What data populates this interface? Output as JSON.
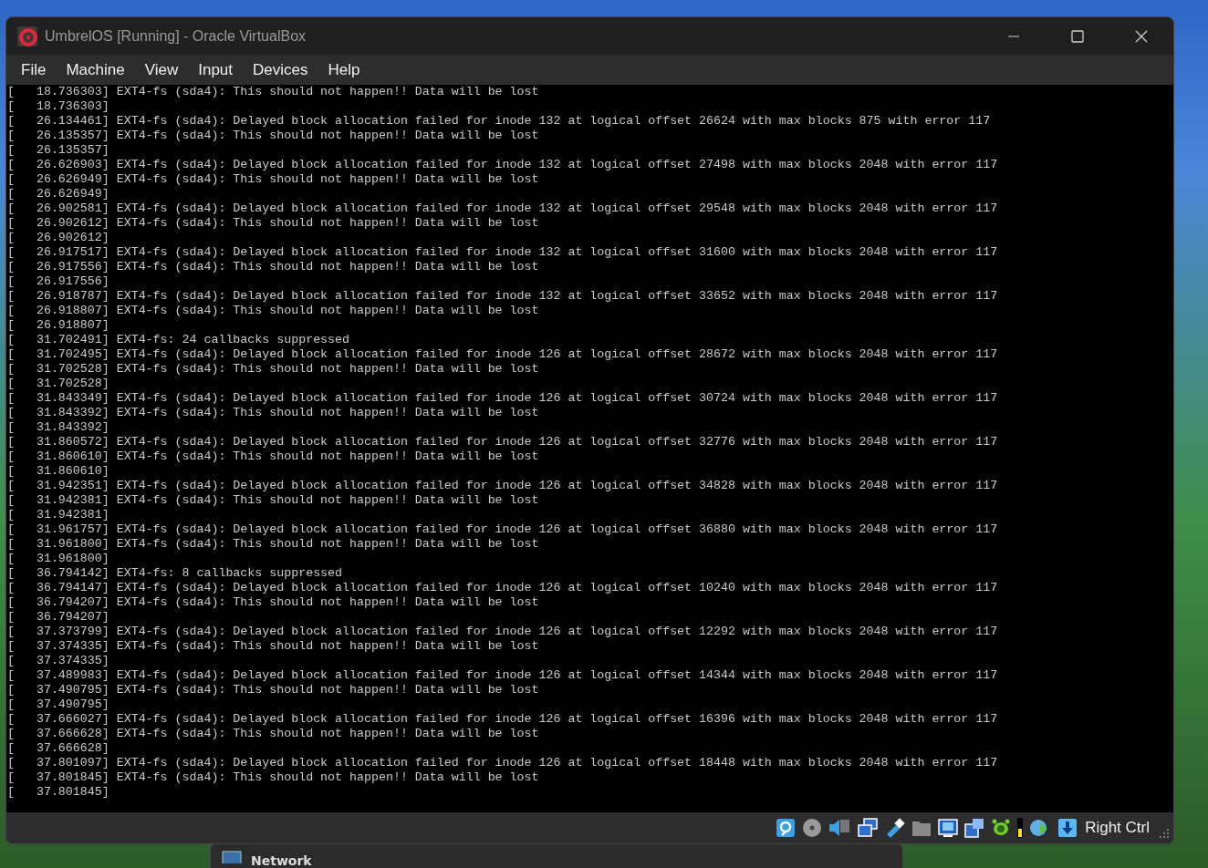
{
  "window": {
    "title": "UmbrelOS [Running] - Oracle VirtualBox"
  },
  "menu": [
    "File",
    "Machine",
    "View",
    "Input",
    "Devices",
    "Help"
  ],
  "console_lines": [
    "[   18.736303] EXT4-fs (sda4): This should not happen!! Data will be lost",
    "[   18.736303]",
    "[   26.134461] EXT4-fs (sda4): Delayed block allocation failed for inode 132 at logical offset 26624 with max blocks 875 with error 117",
    "[   26.135357] EXT4-fs (sda4): This should not happen!! Data will be lost",
    "[   26.135357]",
    "[   26.626903] EXT4-fs (sda4): Delayed block allocation failed for inode 132 at logical offset 27498 with max blocks 2048 with error 117",
    "[   26.626949] EXT4-fs (sda4): This should not happen!! Data will be lost",
    "[   26.626949]",
    "[   26.902581] EXT4-fs (sda4): Delayed block allocation failed for inode 132 at logical offset 29548 with max blocks 2048 with error 117",
    "[   26.902612] EXT4-fs (sda4): This should not happen!! Data will be lost",
    "[   26.902612]",
    "[   26.917517] EXT4-fs (sda4): Delayed block allocation failed for inode 132 at logical offset 31600 with max blocks 2048 with error 117",
    "[   26.917556] EXT4-fs (sda4): This should not happen!! Data will be lost",
    "[   26.917556]",
    "[   26.918787] EXT4-fs (sda4): Delayed block allocation failed for inode 132 at logical offset 33652 with max blocks 2048 with error 117",
    "[   26.918807] EXT4-fs (sda4): This should not happen!! Data will be lost",
    "[   26.918807]",
    "[   31.702491] EXT4-fs: 24 callbacks suppressed",
    "[   31.702495] EXT4-fs (sda4): Delayed block allocation failed for inode 126 at logical offset 28672 with max blocks 2048 with error 117",
    "[   31.702528] EXT4-fs (sda4): This should not happen!! Data will be lost",
    "[   31.702528]",
    "[   31.843349] EXT4-fs (sda4): Delayed block allocation failed for inode 126 at logical offset 30724 with max blocks 2048 with error 117",
    "[   31.843392] EXT4-fs (sda4): This should not happen!! Data will be lost",
    "[   31.843392]",
    "[   31.860572] EXT4-fs (sda4): Delayed block allocation failed for inode 126 at logical offset 32776 with max blocks 2048 with error 117",
    "[   31.860610] EXT4-fs (sda4): This should not happen!! Data will be lost",
    "[   31.860610]",
    "[   31.942351] EXT4-fs (sda4): Delayed block allocation failed for inode 126 at logical offset 34828 with max blocks 2048 with error 117",
    "[   31.942381] EXT4-fs (sda4): This should not happen!! Data will be lost",
    "[   31.942381]",
    "[   31.961757] EXT4-fs (sda4): Delayed block allocation failed for inode 126 at logical offset 36880 with max blocks 2048 with error 117",
    "[   31.961800] EXT4-fs (sda4): This should not happen!! Data will be lost",
    "[   31.961800]",
    "[   36.794142] EXT4-fs: 8 callbacks suppressed",
    "[   36.794147] EXT4-fs (sda4): Delayed block allocation failed for inode 126 at logical offset 10240 with max blocks 2048 with error 117",
    "[   36.794207] EXT4-fs (sda4): This should not happen!! Data will be lost",
    "[   36.794207]",
    "[   37.373799] EXT4-fs (sda4): Delayed block allocation failed for inode 126 at logical offset 12292 with max blocks 2048 with error 117",
    "[   37.374335] EXT4-fs (sda4): This should not happen!! Data will be lost",
    "[   37.374335]",
    "[   37.489983] EXT4-fs (sda4): Delayed block allocation failed for inode 126 at logical offset 14344 with max blocks 2048 with error 117",
    "[   37.490795] EXT4-fs (sda4): This should not happen!! Data will be lost",
    "[   37.490795]",
    "[   37.666027] EXT4-fs (sda4): Delayed block allocation failed for inode 126 at logical offset 16396 with max blocks 2048 with error 117",
    "[   37.666628] EXT4-fs (sda4): This should not happen!! Data will be lost",
    "[   37.666628]",
    "[   37.801097] EXT4-fs (sda4): Delayed block allocation failed for inode 126 at logical offset 18448 with max blocks 2048 with error 117",
    "[   37.801845] EXT4-fs (sda4): This should not happen!! Data will be lost",
    "[   37.801845]"
  ],
  "status_bar": {
    "host_key": "Right Ctrl"
  },
  "background_window": {
    "title": "Network"
  }
}
